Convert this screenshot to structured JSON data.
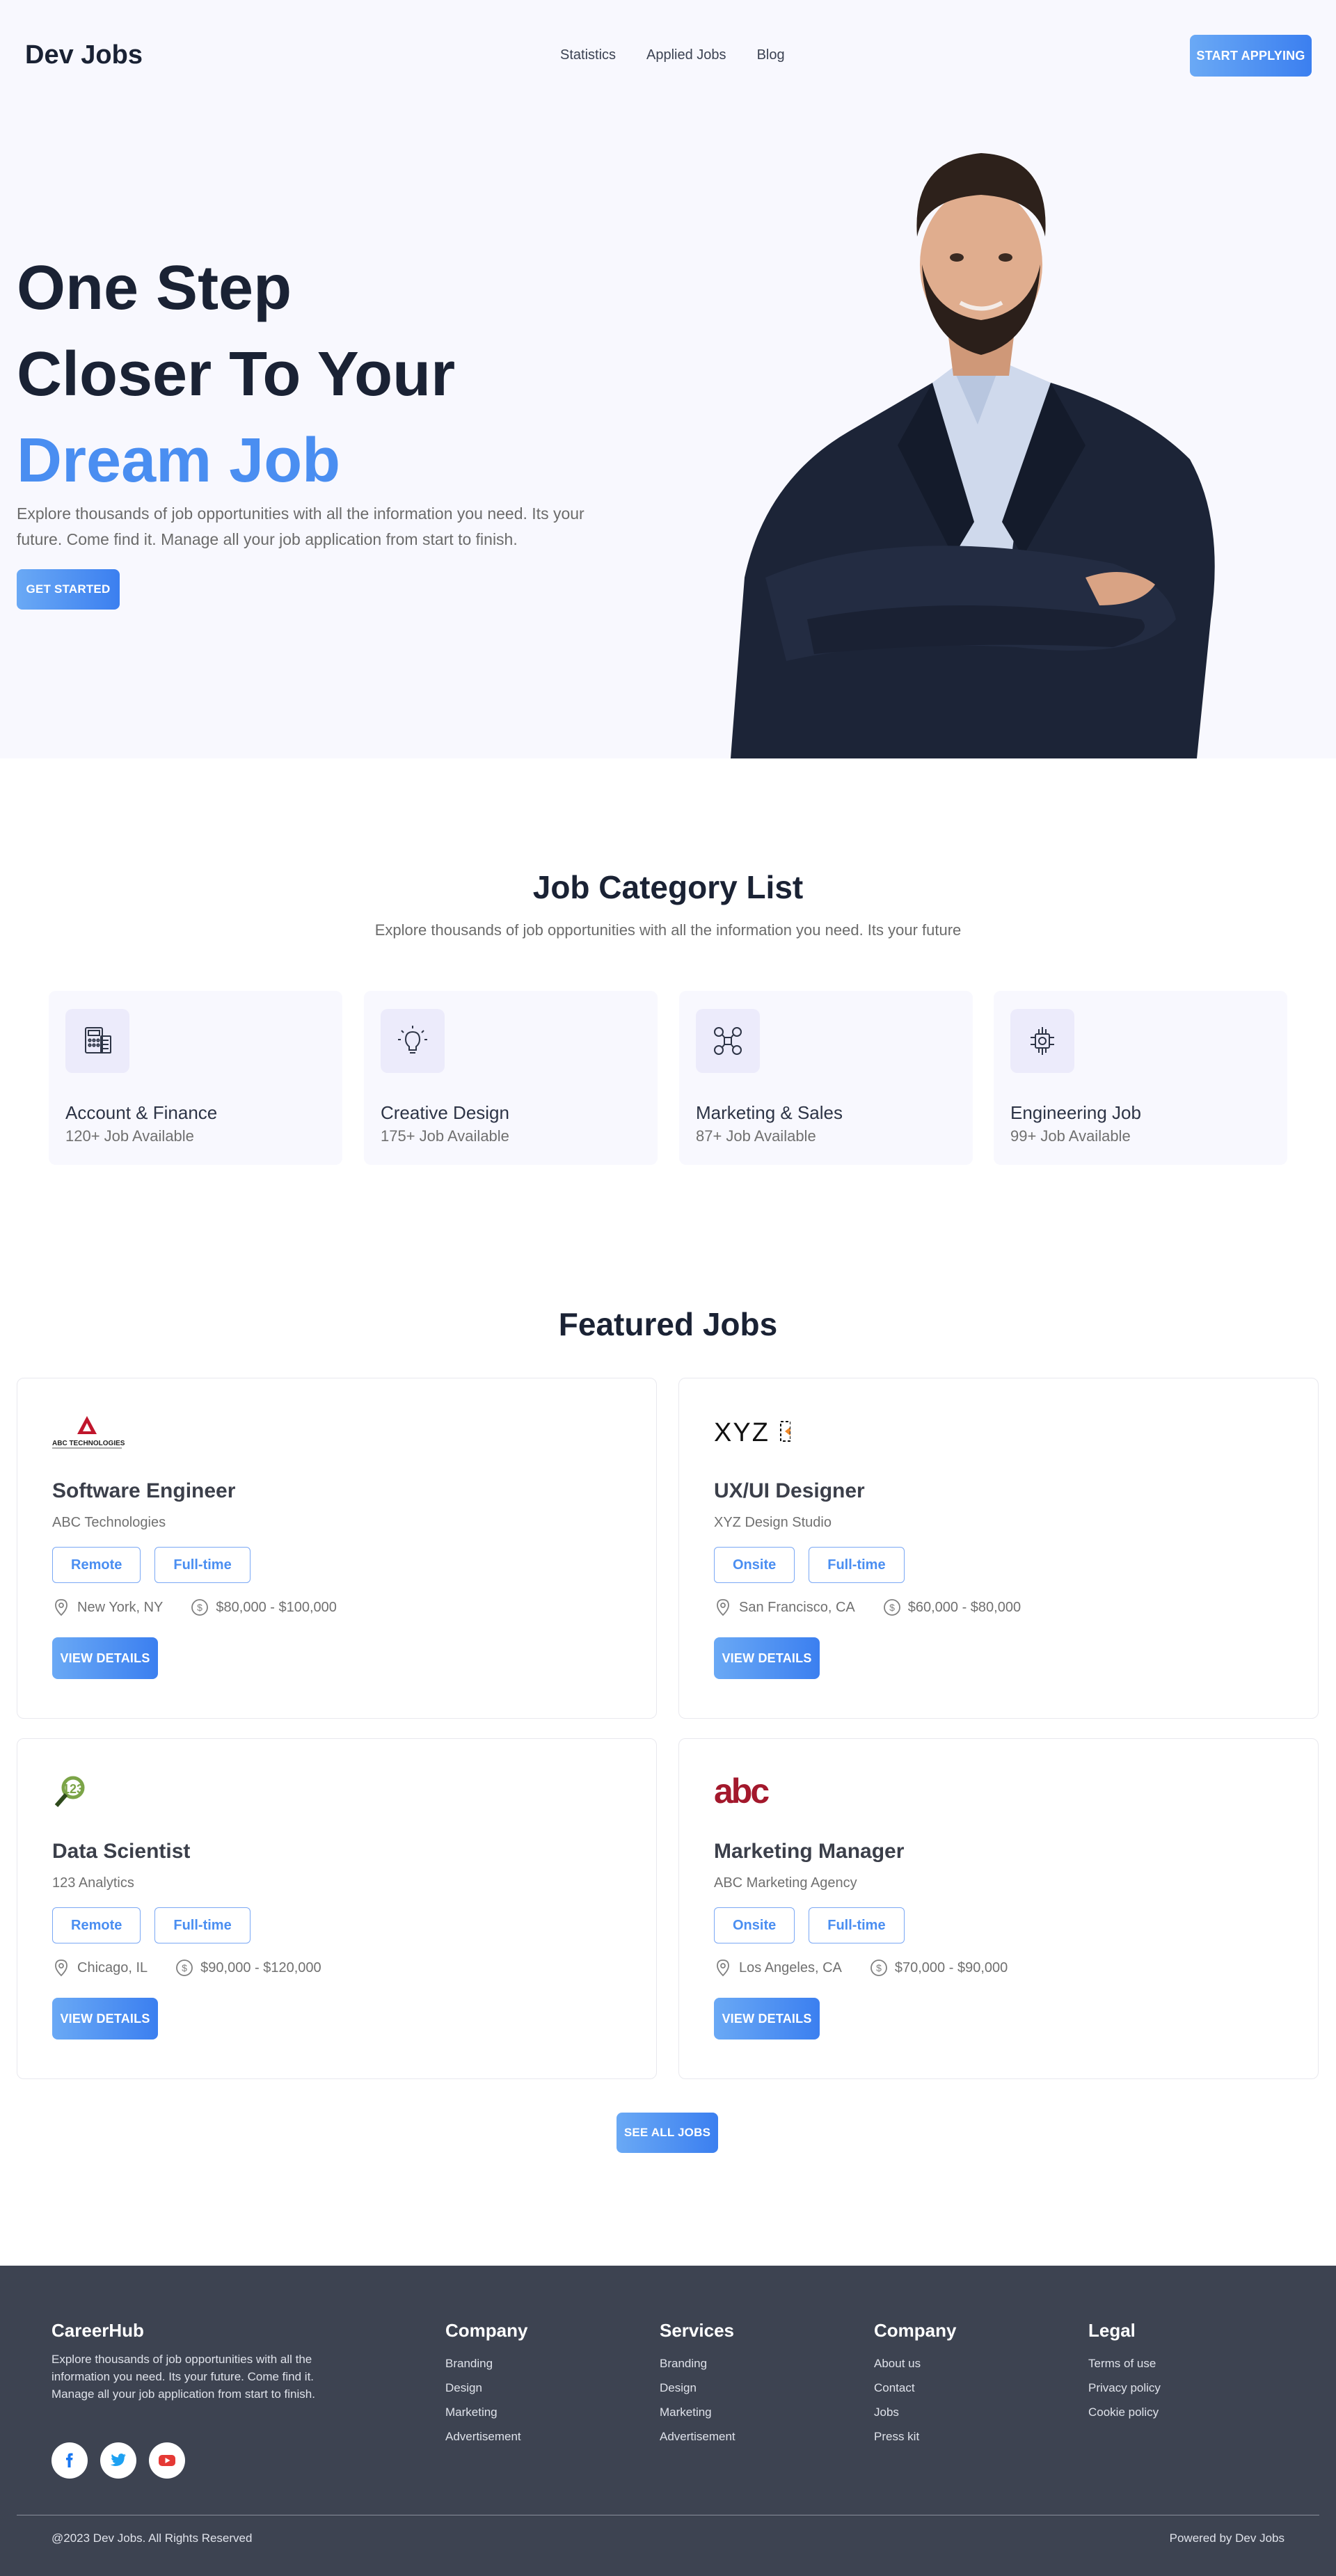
{
  "header": {
    "logo": "Dev Jobs",
    "nav": [
      "Statistics",
      "Applied Jobs",
      "Blog"
    ],
    "cta": "START APPLYING"
  },
  "hero": {
    "title_line1": "One Step",
    "title_line2": "Closer To Your",
    "title_accent": "Dream Job",
    "description": "Explore thousands of job opportunities with all the information you need. Its your future. Come find it. Manage all your job application from start to finish.",
    "cta": "GET STARTED"
  },
  "categories": {
    "title": "Job Category List",
    "subtitle": "Explore thousands of job opportunities with all the information you need. Its your future",
    "items": [
      {
        "name": "Account & Finance",
        "count": "120+ Job Available",
        "icon": "calculator-icon"
      },
      {
        "name": "Creative Design",
        "count": "175+ Job Available",
        "icon": "lightbulb-icon"
      },
      {
        "name": "Marketing & Sales",
        "count": "87+ Job Available",
        "icon": "social-network-icon"
      },
      {
        "name": "Engineering Job",
        "count": "99+ Job Available",
        "icon": "chip-icon"
      }
    ]
  },
  "featured": {
    "title": "Featured Jobs",
    "view_label": "VIEW DETAILS",
    "see_all": "SEE ALL JOBS",
    "jobs": [
      {
        "title": "Software Engineer",
        "company": "ABC Technologies",
        "tag1": "Remote",
        "tag2": "Full-time",
        "location": "New York, NY",
        "salary": "$80,000 - $100,000",
        "logo_text": "ABC TECHNOLOGIES"
      },
      {
        "title": "UX/UI Designer",
        "company": "XYZ Design Studio",
        "tag1": "Onsite",
        "tag2": "Full-time",
        "location": "San Francisco, CA",
        "salary": "$60,000 - $80,000",
        "logo_text": "XYZ"
      },
      {
        "title": "Data Scientist",
        "company": "123 Analytics",
        "tag1": "Remote",
        "tag2": "Full-time",
        "location": "Chicago, IL",
        "salary": "$90,000 - $120,000",
        "logo_text": "123"
      },
      {
        "title": "Marketing Manager",
        "company": "ABC Marketing Agency",
        "tag1": "Onsite",
        "tag2": "Full-time",
        "location": "Los Angeles, CA",
        "salary": "$70,000 - $90,000",
        "logo_text": "abc"
      }
    ]
  },
  "footer": {
    "brand": "CareerHub",
    "about": "Explore thousands of job opportunities with all the information you need. Its your future. Come find it. Manage all your job application from start to finish.",
    "columns": [
      {
        "title": "Company",
        "links": [
          "Branding",
          "Design",
          "Marketing",
          "Advertisement"
        ]
      },
      {
        "title": "Services",
        "links": [
          "Branding",
          "Design",
          "Marketing",
          "Advertisement"
        ]
      },
      {
        "title": "Company",
        "links": [
          "About us",
          "Contact",
          "Jobs",
          "Press kit"
        ]
      },
      {
        "title": "Legal",
        "links": [
          "Terms of use",
          "Privacy policy",
          "Cookie policy"
        ]
      }
    ],
    "copyright": "@2023 Dev Jobs. All Rights Reserved",
    "powered": "Powered by Dev Jobs"
  },
  "colors": {
    "accent": "#4a8ef1",
    "dark": "#1a2234",
    "footer_bg": "#3d4351",
    "hero_bg": "#f8f8fe"
  }
}
